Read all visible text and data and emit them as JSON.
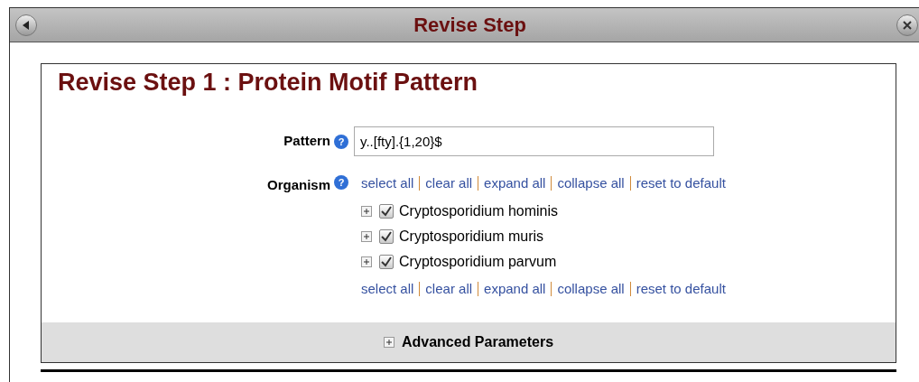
{
  "dialog": {
    "title": "Revise Step"
  },
  "heading": "Revise Step 1 : Protein Motif Pattern",
  "pattern": {
    "label": "Pattern",
    "help": "?",
    "value": "y..[fty].{1,20}$"
  },
  "organism": {
    "label": "Organism",
    "help": "?",
    "links_top": [
      "select all",
      "clear all",
      "expand all",
      "collapse all",
      "reset to default"
    ],
    "items": [
      {
        "label": "Cryptosporidium hominis",
        "checked": true,
        "expanded": false
      },
      {
        "label": "Cryptosporidium muris",
        "checked": true,
        "expanded": false
      },
      {
        "label": "Cryptosporidium parvum",
        "checked": true,
        "expanded": false
      }
    ],
    "links_bottom": [
      "select all",
      "clear all",
      "expand all",
      "collapse all",
      "reset to default"
    ]
  },
  "advanced": {
    "label": "Advanced Parameters",
    "expanded": false
  }
}
